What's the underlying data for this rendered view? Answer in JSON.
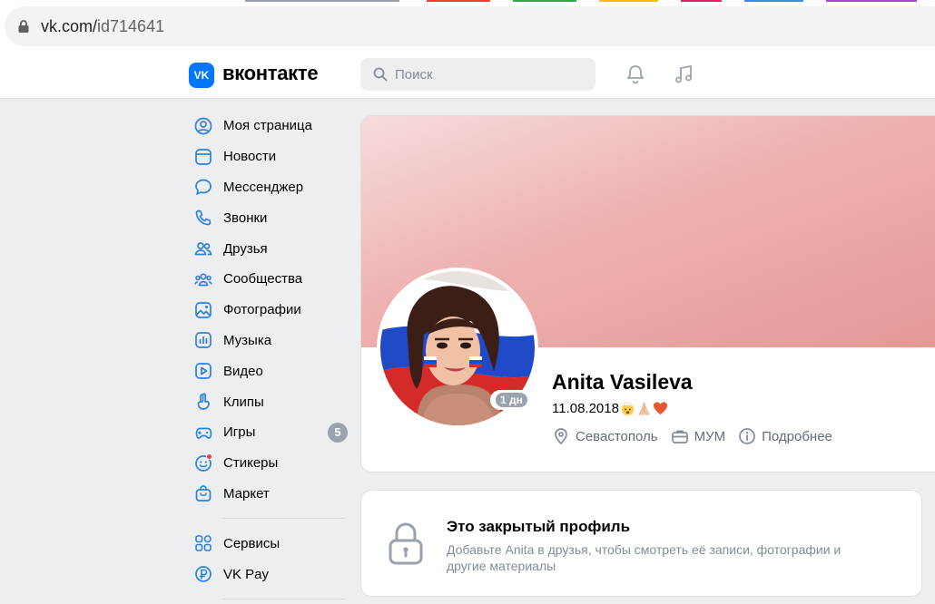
{
  "browser": {
    "url_domain": "vk.com/",
    "url_path": "id714641"
  },
  "header": {
    "logo_letter": "VK",
    "brand": "вконтакте",
    "search_placeholder": "Поиск"
  },
  "sidebar": {
    "items": [
      {
        "label": "Моя страница",
        "icon": "user-circle-icon"
      },
      {
        "label": "Новости",
        "icon": "newsfeed-icon"
      },
      {
        "label": "Мессенджер",
        "icon": "message-icon"
      },
      {
        "label": "Звонки",
        "icon": "phone-icon"
      },
      {
        "label": "Друзья",
        "icon": "friends-icon"
      },
      {
        "label": "Сообщества",
        "icon": "communities-icon"
      },
      {
        "label": "Фотографии",
        "icon": "photos-icon"
      },
      {
        "label": "Музыка",
        "icon": "music-icon"
      },
      {
        "label": "Видео",
        "icon": "video-icon"
      },
      {
        "label": "Клипы",
        "icon": "clips-icon"
      },
      {
        "label": "Игры",
        "icon": "gamepad-icon",
        "badge": "5"
      },
      {
        "label": "Стикеры",
        "icon": "sticker-icon"
      },
      {
        "label": "Маркет",
        "icon": "market-icon"
      }
    ],
    "extra_items": [
      {
        "label": "Сервисы",
        "icon": "services-icon"
      },
      {
        "label": "VK Pay",
        "icon": "vkpay-icon"
      }
    ]
  },
  "profile": {
    "name": "Anita Vasileva",
    "status_text": "11.08.2018",
    "online_label": "1 дн",
    "city": "Севастополь",
    "work": "МУМ",
    "more_label": "Подробнее"
  },
  "closed_profile": {
    "title": "Это закрытый профиль",
    "description": "Добавьте Anita в друзья, чтобы смотреть её записи, фотографии и другие материалы"
  },
  "colors": {
    "accent": "#0077ff",
    "icon": "#2d81e0",
    "page_bg": "#edeef0",
    "muted_text": "#818c99"
  }
}
